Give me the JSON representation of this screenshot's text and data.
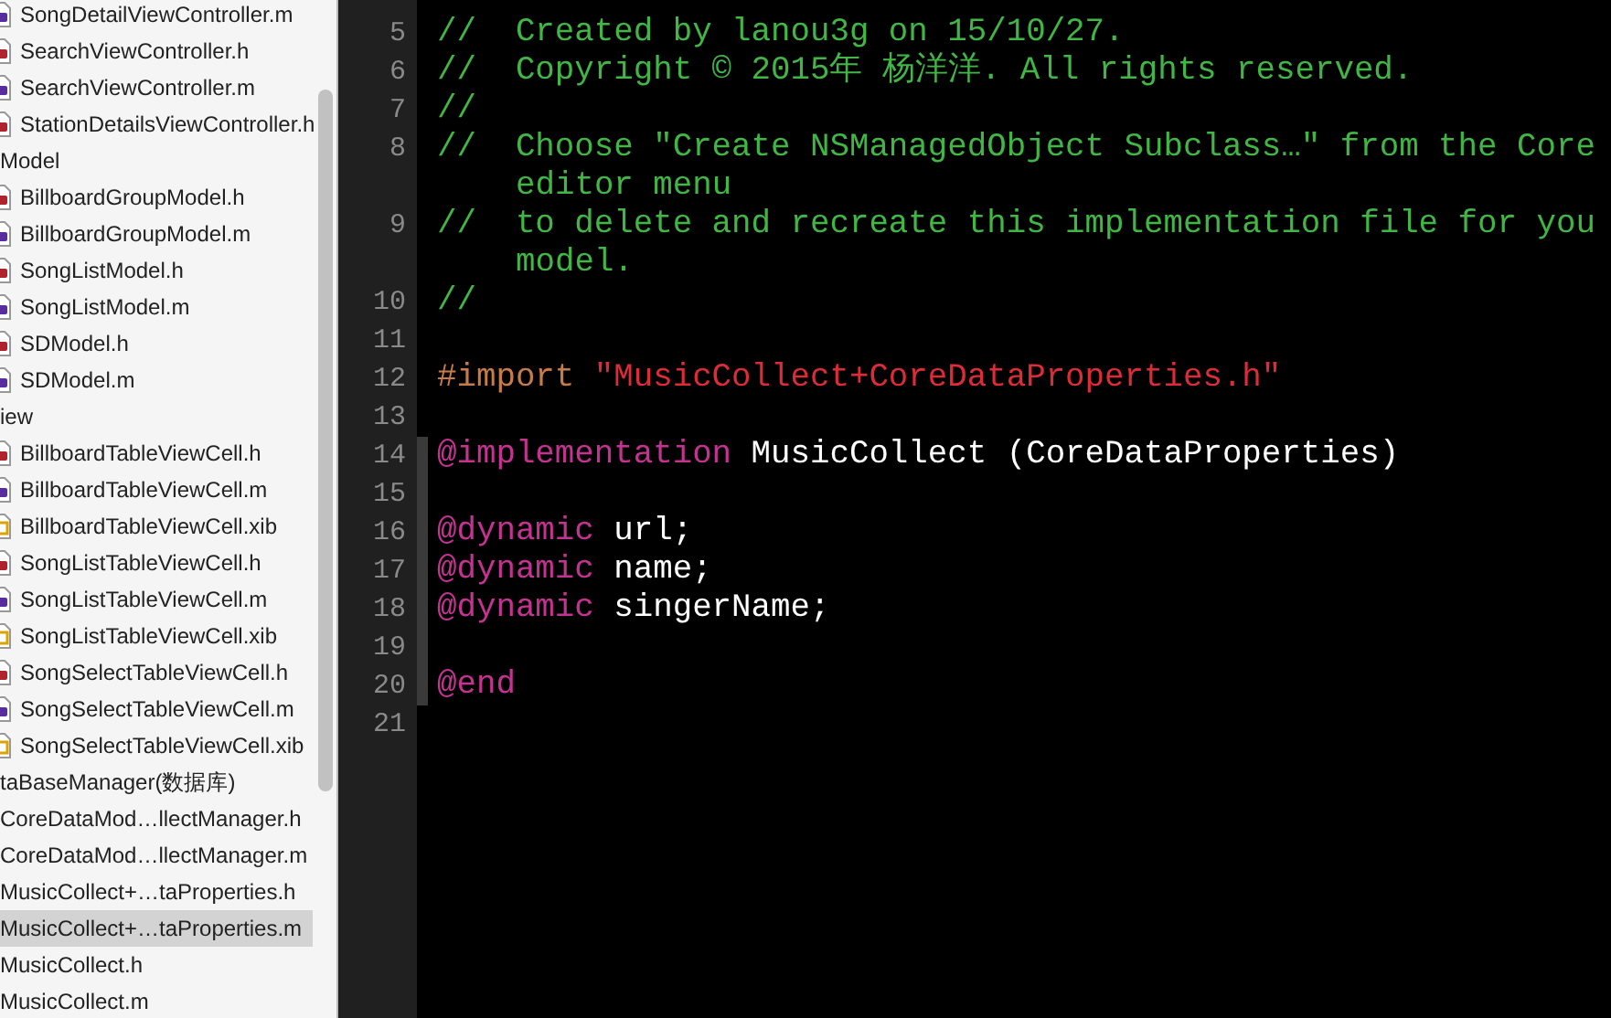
{
  "navigator": {
    "items": [
      {
        "label": "SongDetailViewController.m",
        "kind": "m",
        "selected": false
      },
      {
        "label": "SearchViewController.h",
        "kind": "h",
        "selected": false
      },
      {
        "label": "SearchViewController.m",
        "kind": "m",
        "selected": false
      },
      {
        "label": "StationDetailsViewController.h",
        "kind": "h",
        "selected": false
      },
      {
        "label": "Model",
        "kind": "group",
        "selected": false
      },
      {
        "label": "BillboardGroupModel.h",
        "kind": "h",
        "selected": false
      },
      {
        "label": "BillboardGroupModel.m",
        "kind": "m",
        "selected": false
      },
      {
        "label": "SongListModel.h",
        "kind": "h",
        "selected": false
      },
      {
        "label": "SongListModel.m",
        "kind": "m",
        "selected": false
      },
      {
        "label": "SDModel.h",
        "kind": "h",
        "selected": false
      },
      {
        "label": "SDModel.m",
        "kind": "m",
        "selected": false
      },
      {
        "label": "iew",
        "kind": "group",
        "selected": false
      },
      {
        "label": "BillboardTableViewCell.h",
        "kind": "h",
        "selected": false
      },
      {
        "label": "BillboardTableViewCell.m",
        "kind": "m",
        "selected": false
      },
      {
        "label": "BillboardTableViewCell.xib",
        "kind": "xib",
        "selected": false
      },
      {
        "label": "SongListTableViewCell.h",
        "kind": "h",
        "selected": false
      },
      {
        "label": "SongListTableViewCell.m",
        "kind": "m",
        "selected": false
      },
      {
        "label": "SongListTableViewCell.xib",
        "kind": "xib",
        "selected": false
      },
      {
        "label": "SongSelectTableViewCell.h",
        "kind": "h",
        "selected": false
      },
      {
        "label": "SongSelectTableViewCell.m",
        "kind": "m",
        "selected": false
      },
      {
        "label": "SongSelectTableViewCell.xib",
        "kind": "xib",
        "selected": false
      },
      {
        "label": "taBaseManager(数据库)",
        "kind": "group",
        "selected": false
      },
      {
        "label": "CoreDataMod…llectManager.h",
        "kind": "group",
        "selected": false
      },
      {
        "label": "CoreDataMod…llectManager.m",
        "kind": "group",
        "selected": false
      },
      {
        "label": "MusicCollect+…taProperties.h",
        "kind": "group",
        "selected": false
      },
      {
        "label": "MusicCollect+…taProperties.m",
        "kind": "group",
        "selected": true
      },
      {
        "label": "MusicCollect.h",
        "kind": "group",
        "selected": false
      },
      {
        "label": "MusicCollect.m",
        "kind": "group",
        "selected": false
      }
    ]
  },
  "editor": {
    "lines": [
      {
        "number": "5",
        "scope": false,
        "tokens": [
          {
            "kind": "comment",
            "text": "//  Created by lanou3g on 15/10/27."
          }
        ]
      },
      {
        "number": "6",
        "scope": false,
        "tokens": [
          {
            "kind": "comment",
            "text": "//  Copyright © 2015年 杨洋洋. All rights reserved."
          }
        ]
      },
      {
        "number": "7",
        "scope": false,
        "tokens": [
          {
            "kind": "comment",
            "text": "//"
          }
        ]
      },
      {
        "number": "8",
        "scope": false,
        "tokens": [
          {
            "kind": "comment",
            "text": "//  Choose \"Create NSManagedObject Subclass…\" from the Core"
          }
        ],
        "continuation": "editor menu"
      },
      {
        "number": "9",
        "scope": false,
        "tokens": [
          {
            "kind": "comment",
            "text": "//  to delete and recreate this implementation file for you"
          }
        ],
        "continuation": "model."
      },
      {
        "number": "10",
        "scope": false,
        "tokens": [
          {
            "kind": "comment",
            "text": "//"
          }
        ]
      },
      {
        "number": "11",
        "scope": false
      },
      {
        "number": "12",
        "scope": false,
        "tokens": [
          {
            "kind": "directive",
            "text": "#import"
          },
          {
            "kind": "string",
            "text": " \"MusicCollect+CoreDataProperties.h\""
          }
        ]
      },
      {
        "number": "13",
        "scope": false
      },
      {
        "number": "14",
        "scope": true,
        "tokens": [
          {
            "kind": "keyword",
            "text": "@implementation"
          },
          {
            "kind": "plain",
            "text": " MusicCollect (CoreDataProperties)"
          }
        ]
      },
      {
        "number": "15",
        "scope": true
      },
      {
        "number": "16",
        "scope": true,
        "tokens": [
          {
            "kind": "keyword",
            "text": "@dynamic"
          },
          {
            "kind": "plain",
            "text": " url;"
          }
        ]
      },
      {
        "number": "17",
        "scope": true,
        "tokens": [
          {
            "kind": "keyword",
            "text": "@dynamic"
          },
          {
            "kind": "plain",
            "text": " name;"
          }
        ]
      },
      {
        "number": "18",
        "scope": true,
        "tokens": [
          {
            "kind": "keyword",
            "text": "@dynamic"
          },
          {
            "kind": "plain",
            "text": " singerName;"
          }
        ]
      },
      {
        "number": "19",
        "scope": true
      },
      {
        "number": "20",
        "scope": true,
        "tokens": [
          {
            "kind": "keyword",
            "text": "@end"
          }
        ]
      },
      {
        "number": "21",
        "scope": false
      }
    ]
  }
}
